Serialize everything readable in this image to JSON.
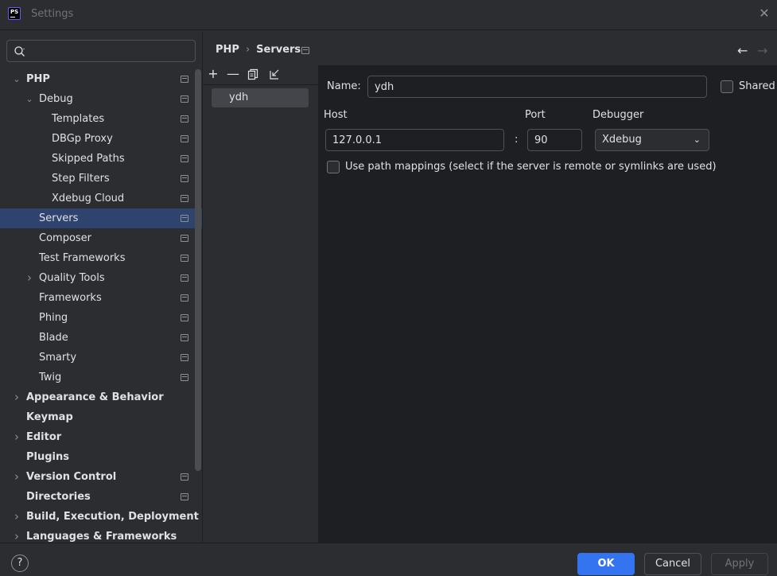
{
  "window": {
    "title": "Settings",
    "app_icon_text": "PS"
  },
  "search": {
    "placeholder": ""
  },
  "tree": [
    {
      "label": "PHP",
      "level": 0,
      "expanded": true,
      "bold": true,
      "project": true
    },
    {
      "label": "Debug",
      "level": 1,
      "expanded": true,
      "bold": false,
      "project": true
    },
    {
      "label": "Templates",
      "level": 2,
      "bold": false,
      "project": true
    },
    {
      "label": "DBGp Proxy",
      "level": 2,
      "bold": false,
      "project": true
    },
    {
      "label": "Skipped Paths",
      "level": 2,
      "bold": false,
      "project": true
    },
    {
      "label": "Step Filters",
      "level": 2,
      "bold": false,
      "project": true
    },
    {
      "label": "Xdebug Cloud",
      "level": 2,
      "bold": false,
      "project": true
    },
    {
      "label": "Servers",
      "level": 1,
      "bold": false,
      "project": true,
      "selected": true
    },
    {
      "label": "Composer",
      "level": 1,
      "bold": false,
      "project": true
    },
    {
      "label": "Test Frameworks",
      "level": 1,
      "bold": false,
      "project": true
    },
    {
      "label": "Quality Tools",
      "level": 1,
      "collapsed": true,
      "bold": false,
      "project": true
    },
    {
      "label": "Frameworks",
      "level": 1,
      "bold": false,
      "project": true
    },
    {
      "label": "Phing",
      "level": 1,
      "bold": false,
      "project": true
    },
    {
      "label": "Blade",
      "level": 1,
      "bold": false,
      "project": true
    },
    {
      "label": "Smarty",
      "level": 1,
      "bold": false,
      "project": true
    },
    {
      "label": "Twig",
      "level": 1,
      "bold": false,
      "project": true
    },
    {
      "label": "Appearance & Behavior",
      "level": 0,
      "collapsed": true,
      "bold": true,
      "project": false
    },
    {
      "label": "Keymap",
      "level": 0,
      "bold": true,
      "project": false
    },
    {
      "label": "Editor",
      "level": 0,
      "collapsed": true,
      "bold": true,
      "project": false
    },
    {
      "label": "Plugins",
      "level": 0,
      "bold": true,
      "project": false
    },
    {
      "label": "Version Control",
      "level": 0,
      "collapsed": true,
      "bold": true,
      "project": true
    },
    {
      "label": "Directories",
      "level": 0,
      "bold": true,
      "project": true
    },
    {
      "label": "Build, Execution, Deployment",
      "level": 0,
      "collapsed": true,
      "bold": true,
      "project": false
    },
    {
      "label": "Languages & Frameworks",
      "level": 0,
      "collapsed": true,
      "bold": true,
      "project": false
    }
  ],
  "breadcrumb": {
    "parent": "PHP",
    "separator": "›",
    "current": "Servers"
  },
  "servers": {
    "items": [
      "ydh"
    ]
  },
  "form": {
    "name_label": "Name:",
    "name_value": "ydh",
    "shared_label": "Shared",
    "host_label": "Host",
    "host_value": "127.0.0.1",
    "colon": ":",
    "port_label": "Port",
    "port_value": "90",
    "debugger_label": "Debugger",
    "debugger_value": "Xdebug",
    "path_mappings_label": "Use path mappings (select if the server is remote or symlinks are used)"
  },
  "buttons": {
    "help": "?",
    "ok": "OK",
    "cancel": "Cancel",
    "apply": "Apply"
  },
  "colors": {
    "accent": "#3574f0",
    "selection": "#2e436e",
    "background": "#2b2d30",
    "panel": "#1e1f22"
  }
}
